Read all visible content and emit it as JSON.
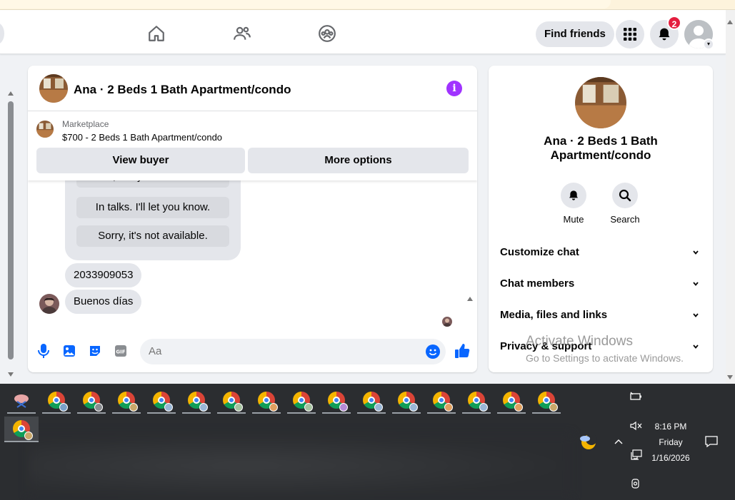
{
  "browser": {
    "url_fragment": ""
  },
  "nav": {
    "find_friends": "Find friends",
    "notification_count": "2"
  },
  "chat": {
    "title": "Ana · 2 Beds 1 Bath Apartment/condo",
    "marketplace_label": "Marketplace",
    "listing": "$700 - 2 Beds 1 Bath Apartment/condo",
    "view_buyer": "View buyer",
    "more_options": "More options",
    "quick_replies": [
      "Yes, are you interested?",
      "In talks. I'll let you know.",
      "Sorry, it's not available."
    ],
    "messages": [
      "2033909053",
      "Buenos días"
    ],
    "composer_placeholder": "Aa"
  },
  "panel": {
    "title": "Ana · 2 Beds 1 Bath Apartment/condo",
    "mute": "Mute",
    "search": "Search",
    "sections": [
      "Customize chat",
      "Chat members",
      "Media, files and links",
      "Privacy & support"
    ]
  },
  "watermark": {
    "line1": "Activate Windows",
    "line2": "Go to Settings to activate Windows."
  },
  "taskbar": {
    "time": "8:16 PM",
    "day": "Friday",
    "date": "1/16/2026"
  },
  "colors": {
    "brand_blue": "#0866ff",
    "info_purple": "#a033ff",
    "badge_red": "#e41e3f"
  }
}
